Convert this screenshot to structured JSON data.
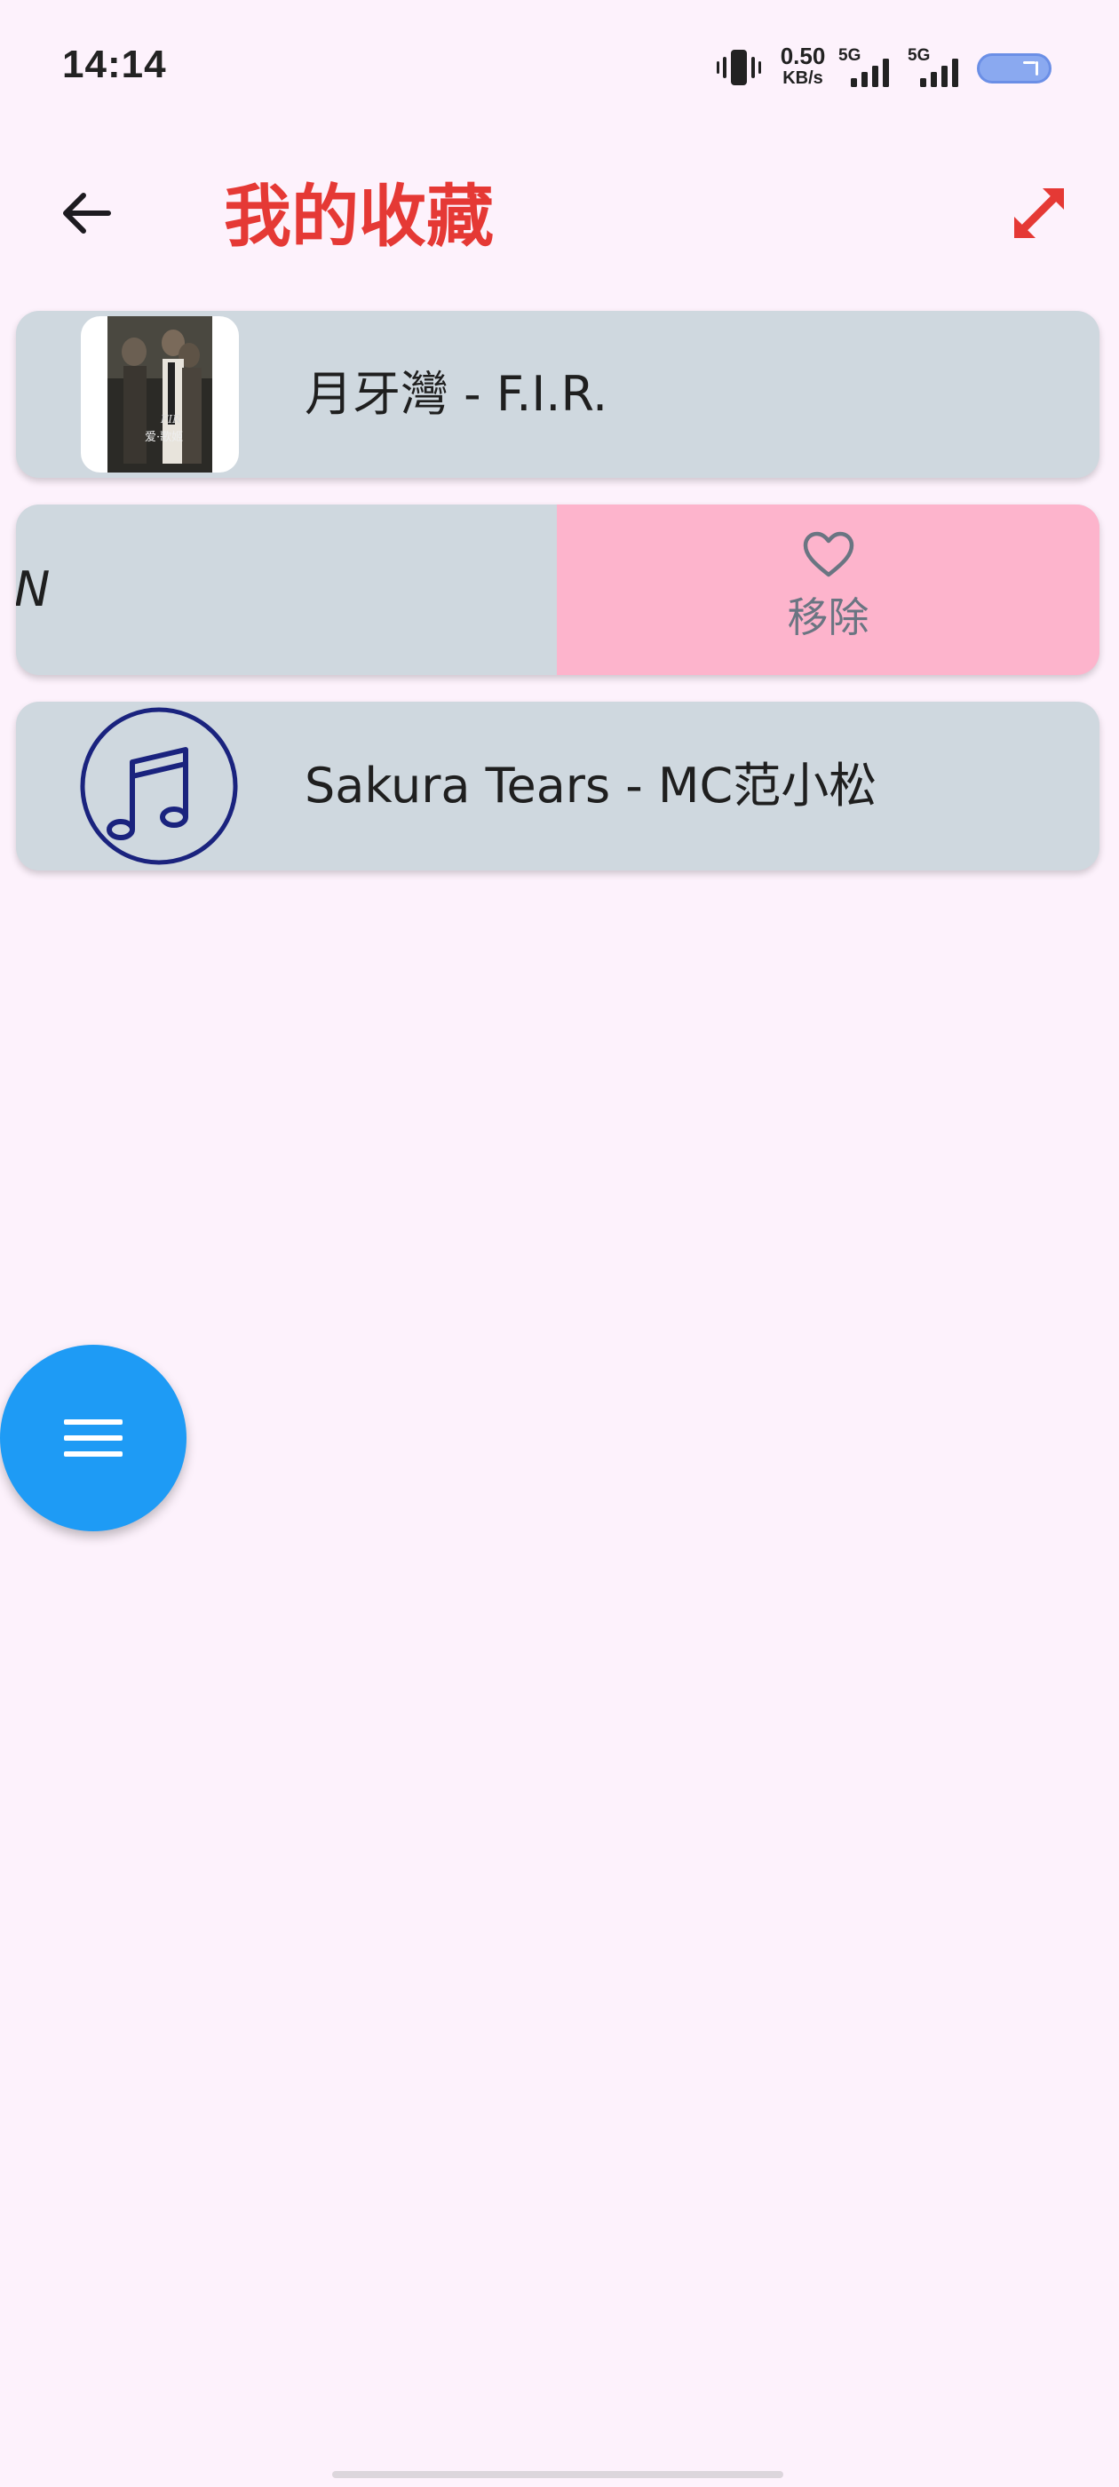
{
  "status_bar": {
    "time": "14:14",
    "net_speed_value": "0.50",
    "net_speed_unit": "KB/s",
    "sim1_type": "5G",
    "sim2_type": "5G",
    "icons": [
      "vibrate-icon",
      "signal-icon",
      "signal-icon",
      "battery-icon"
    ]
  },
  "app_bar": {
    "title": "我的收藏",
    "title_color": "#e53935",
    "back_icon": "arrow-left-icon",
    "expand_icon": "expand-arrows-icon"
  },
  "favorites": [
    {
      "title": "月牙灣 - F.I.R.",
      "art": "album-cover"
    },
    {
      "partial_title": "N",
      "swipe_action_label": "移除",
      "swipe_action_icon": "heart-outline-icon",
      "swipe_action_color": "#fdb4cc"
    },
    {
      "title": "Sakura Tears - MC范小松",
      "art": "music-note-icon"
    }
  ],
  "fab": {
    "icon": "menu-icon",
    "color": "#1e9bf5"
  }
}
